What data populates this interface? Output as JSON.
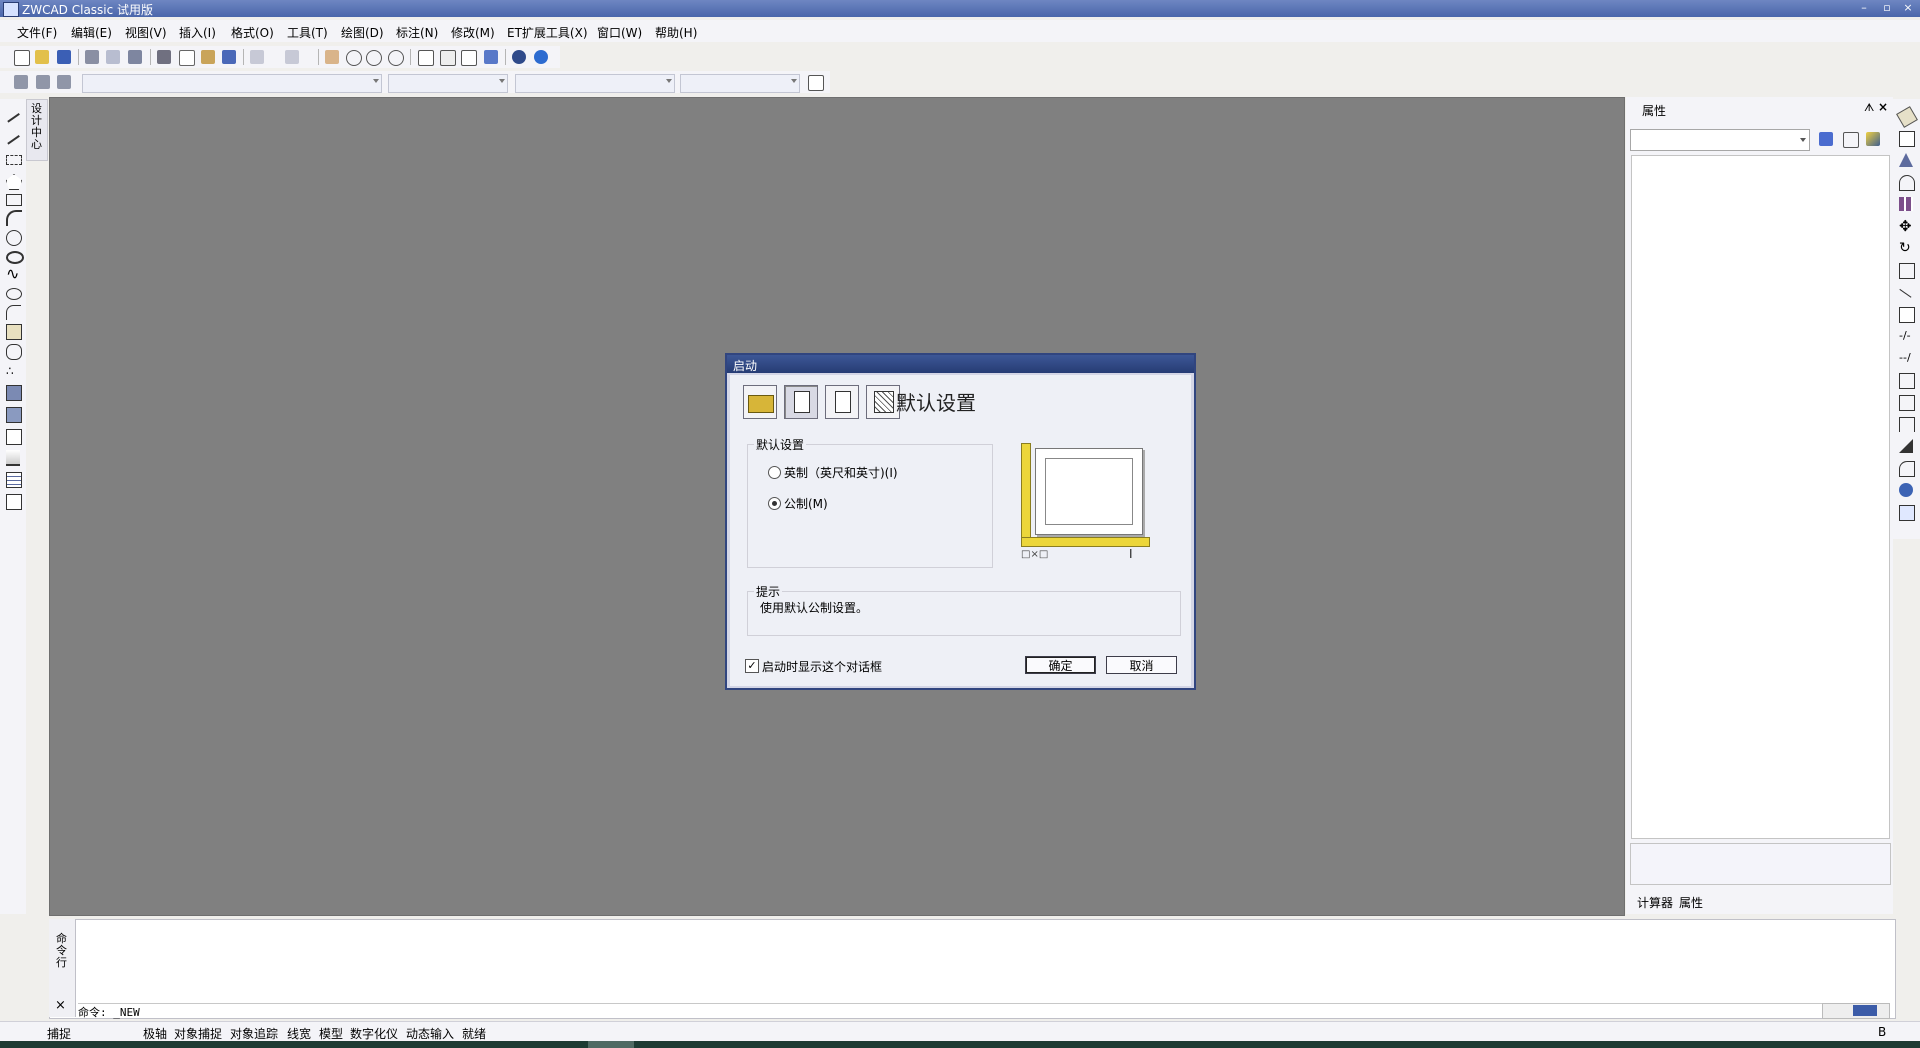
{
  "window": {
    "title": "ZWCAD Classic 试用版",
    "controls": [
      "–",
      "▫",
      "×"
    ]
  },
  "menu": [
    "文件(F)",
    "编辑(E)",
    "视图(V)",
    "插入(I)",
    "格式(O)",
    "工具(T)",
    "绘图(D)",
    "标注(N)",
    "修改(M)",
    "ET扩展工具(X)",
    "窗口(W)",
    "帮助(H)"
  ],
  "tool_palette_tab": "设计中心",
  "properties": {
    "title": "属性",
    "pin": "ᗑ",
    "close": "×",
    "tabs": [
      "计算器",
      "属性"
    ]
  },
  "command": {
    "tab_label": "命令行",
    "close": "×",
    "line": "命令: _NEW"
  },
  "status": [
    "捕捉",
    "极轴",
    "对象捕捉",
    "对象追踪",
    "线宽",
    "模型",
    "数字化仪",
    "动态输入",
    "就绪"
  ],
  "status_right": "B",
  "dialog": {
    "title": "启动",
    "heading": "默认设置",
    "group_label": "默认设置",
    "options": [
      "英制（英尺和英寸)(I)",
      "公制(M)"
    ],
    "selected": 1,
    "hint_label": "提示",
    "hint_text": "使用默认公制设置。",
    "startup_check": "启动时显示这个对话框",
    "ok": "确定",
    "cancel": "取消"
  },
  "colors": {
    "titlebar": "#4a66aa",
    "canvas": "#808080",
    "dialog_title": "#263c74",
    "accent_yellow": "#ecd63a"
  }
}
